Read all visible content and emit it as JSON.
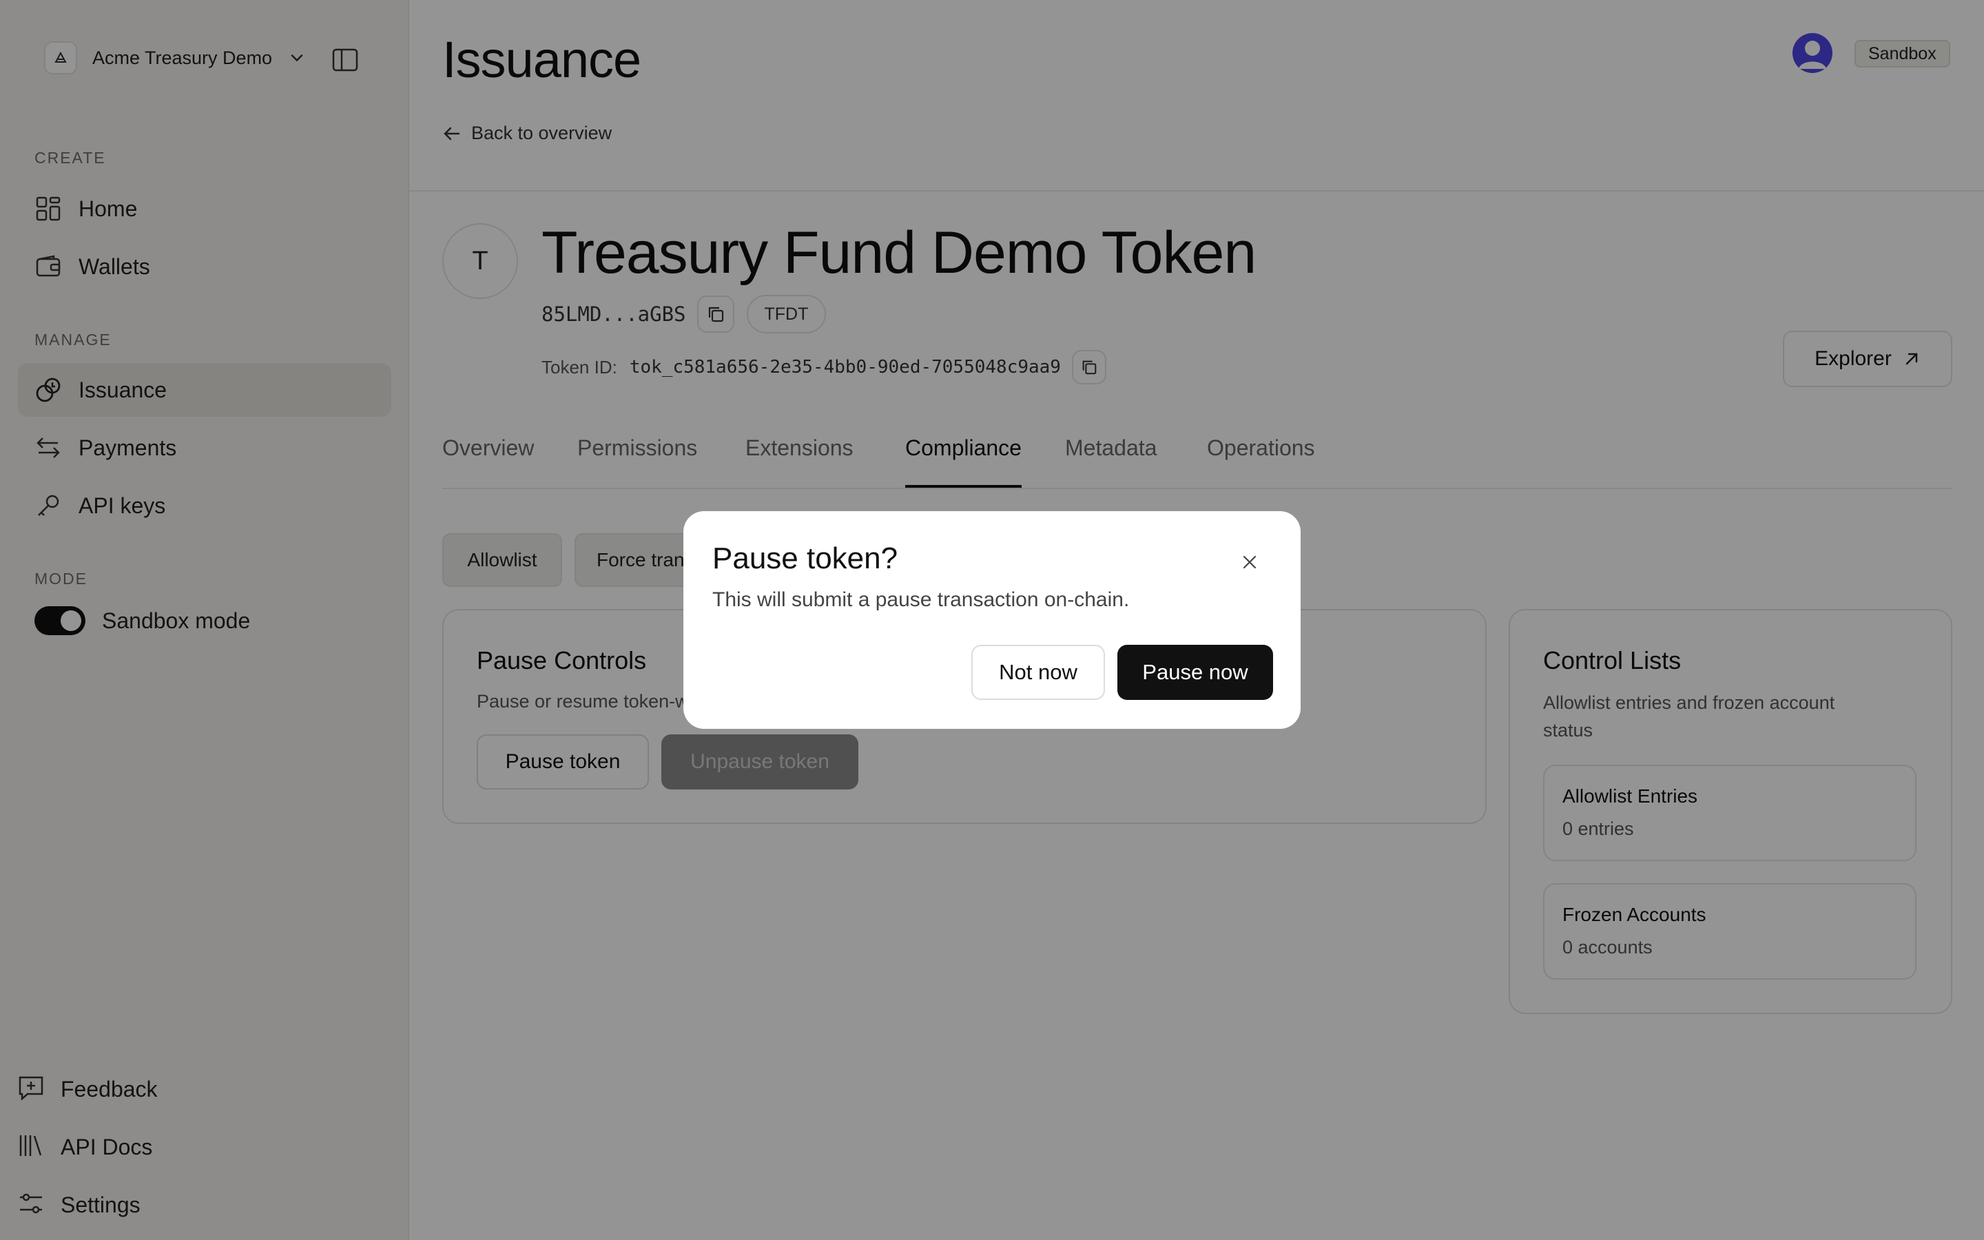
{
  "sidebar": {
    "workspace": {
      "name": "Acme Treasury Demo",
      "icon": "workspace-logo-icon"
    },
    "sections": {
      "create": "CREATE",
      "manage": "MANAGE",
      "mode": "MODE"
    },
    "create_items": [
      {
        "label": "Home",
        "icon": "grid-icon"
      },
      {
        "label": "Wallets",
        "icon": "wallet-icon"
      }
    ],
    "manage_items": [
      {
        "label": "Issuance",
        "icon": "issuance-icon",
        "active": true
      },
      {
        "label": "Payments",
        "icon": "transfer-arrows-icon"
      },
      {
        "label": "API keys",
        "icon": "key-icon"
      }
    ],
    "mode_toggle": {
      "label": "Sandbox mode",
      "on": true
    },
    "footer_items": [
      {
        "label": "Feedback",
        "icon": "feedback-icon"
      },
      {
        "label": "API Docs",
        "icon": "library-icon"
      },
      {
        "label": "Settings",
        "icon": "sliders-icon"
      }
    ]
  },
  "header": {
    "title": "Issuance",
    "back_link": "Back to overview",
    "env_badge": "Sandbox"
  },
  "token": {
    "avatar_letter": "T",
    "name": "Treasury Fund Demo Token",
    "address": "85LMD...aGBS",
    "symbol": "TFDT",
    "token_id_label": "Token ID:",
    "token_id": "tok_c581a656-2e35-4bb0-90ed-7055048c9aa9",
    "explorer_label": "Explorer"
  },
  "tabs": [
    {
      "label": "Overview"
    },
    {
      "label": "Permissions"
    },
    {
      "label": "Extensions"
    },
    {
      "label": "Compliance",
      "active": true
    },
    {
      "label": "Metadata"
    },
    {
      "label": "Operations"
    }
  ],
  "sub_tabs": [
    {
      "label": "Allowlist"
    },
    {
      "label": "Force transfer"
    }
  ],
  "pause_card": {
    "title": "Pause Controls",
    "subtitle": "Pause or resume token-wide transfers",
    "pause_button": "Pause token",
    "unpause_button": "Unpause token"
  },
  "control_lists": {
    "title": "Control Lists",
    "subtitle_line1": "Allowlist entries and frozen account",
    "subtitle_line2": "status",
    "allowlist": {
      "title": "Allowlist Entries",
      "value": "0 entries"
    },
    "frozen": {
      "title": "Frozen Accounts",
      "value": "0 accounts"
    }
  },
  "modal": {
    "title": "Pause token?",
    "description": "This will submit a pause transaction on-chain.",
    "cancel_label": "Not now",
    "confirm_label": "Pause now"
  },
  "colors": {
    "overlay": "rgba(0,0,0,0.42)",
    "primary_button": "#111111",
    "avatar": "#4f46e5"
  }
}
